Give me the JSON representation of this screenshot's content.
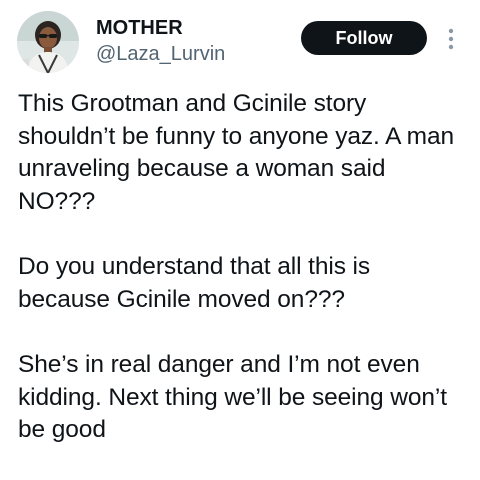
{
  "user": {
    "display_name": "MOTHER",
    "handle": "@Laza_Lurvin",
    "avatar_icon": "profile-photo"
  },
  "actions": {
    "follow_label": "Follow",
    "more_icon": "more-vertical-icon"
  },
  "tweet": {
    "paragraphs": [
      "This Grootman and Gcinile story shouldn’t be funny to anyone yaz. A man unraveling because a woman said NO???",
      "Do you understand that all this is because Gcinile moved on???",
      "She’s in real danger and I’m not even kidding. Next thing we’ll be seeing won’t be good"
    ]
  },
  "colors": {
    "text_primary": "#0f1419",
    "text_secondary": "#536471",
    "follow_bg": "#0f1419",
    "follow_text": "#ffffff"
  }
}
